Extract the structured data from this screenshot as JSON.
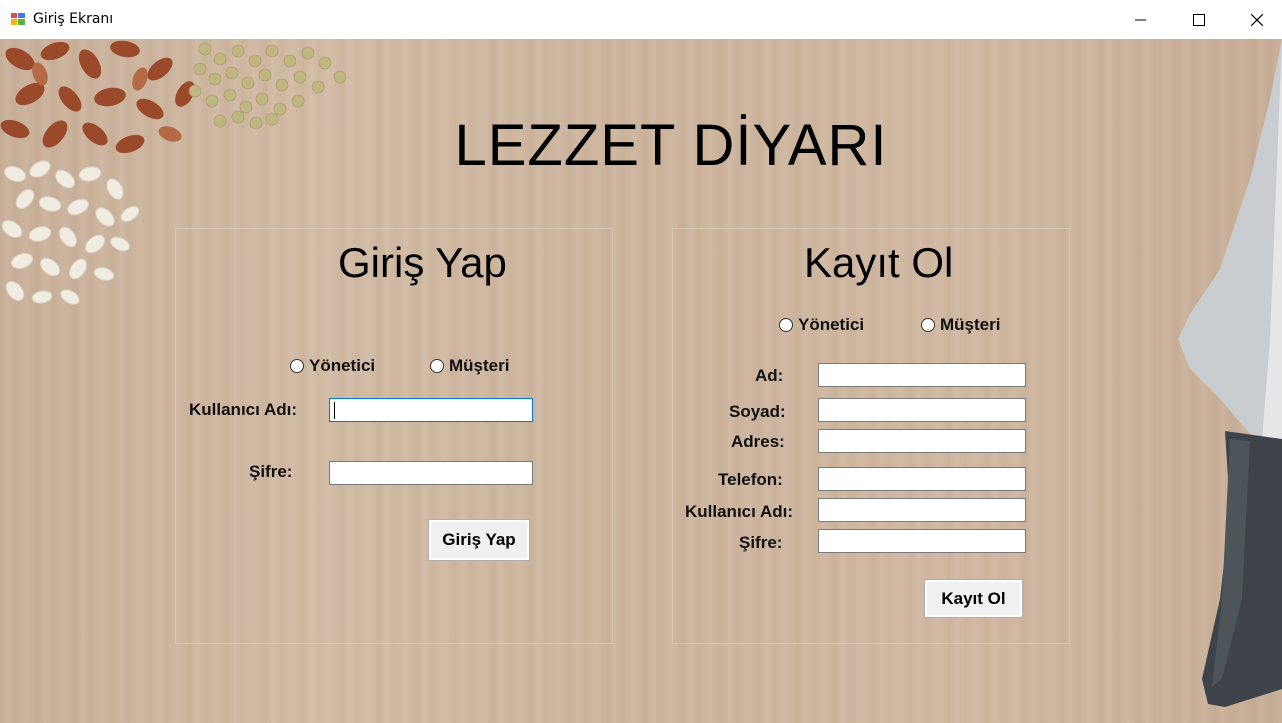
{
  "window": {
    "title": "Giriş Ekranı"
  },
  "app_title": "LEZZET DİYARI",
  "login": {
    "heading": "Giriş Yap",
    "role_options": [
      "Yönetici",
      "Müşteri"
    ],
    "username_label": "Kullanıcı Adı:",
    "username_value": "",
    "password_label": "Şifre:",
    "password_value": "",
    "submit_label": "Giriş Yap"
  },
  "register": {
    "heading": "Kayıt Ol",
    "role_options": [
      "Yönetici",
      "Müşteri"
    ],
    "fields": [
      "Ad:",
      "Soyad:",
      "Adres:",
      "Telefon:",
      "Kullanıcı Adı:",
      "Şifre:"
    ],
    "submit_label": "Kayıt Ol"
  },
  "icons": {
    "app": "winforms-app-icon",
    "minimize": "minimize-icon",
    "maximize": "maximize-icon",
    "close": "close-icon"
  },
  "colors": {
    "focus_border": "#0078d7",
    "background_wood": "#cdb59e"
  }
}
